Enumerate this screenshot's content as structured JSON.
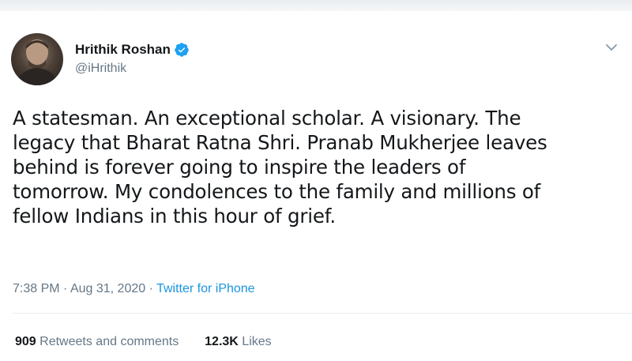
{
  "tweet": {
    "author": {
      "display_name": "Hrithik Roshan",
      "handle": "@iHrithik",
      "verified": true
    },
    "text_lines": [
      "A statesman. An exceptional scholar. A visionary. The",
      "legacy that Bharat Ratna Shri. Pranab Mukherjee leaves",
      "behind is forever going to inspire the leaders of",
      "tomorrow. My condolences to the family and millions of",
      "fellow Indians in this hour of grief."
    ],
    "meta": {
      "time": "7:38 PM",
      "separator": "·",
      "date": "Aug 31, 2020",
      "source": "Twitter for iPhone"
    },
    "stats": {
      "retweets_count": "909",
      "retweets_label": "Retweets and comments",
      "likes_count": "12.3K",
      "likes_label": "Likes"
    }
  },
  "icons": {
    "verified": "verified-badge-icon",
    "menu": "chevron-down-icon"
  },
  "colors": {
    "text": "#14171a",
    "secondary": "#657786",
    "accent": "#1b95e0",
    "divider": "#e6ecf0"
  }
}
